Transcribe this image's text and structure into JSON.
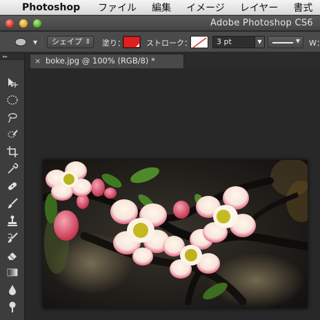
{
  "menubar": {
    "app_name": "Photoshop",
    "menus": [
      "ファイル",
      "編集",
      "イメージ",
      "レイヤー",
      "書式"
    ]
  },
  "window": {
    "title": "Adobe Photoshop CS6"
  },
  "options_bar": {
    "mode": "シェイプ",
    "fill_label": "塗り：",
    "fill_color": "#e02020",
    "stroke_label": "ストローク：",
    "stroke_width": "3 pt",
    "w_label": "W："
  },
  "document": {
    "tab_title": "boke.jpg @ 100% (RGB/8) *",
    "close_glyph": "×"
  },
  "tools": [
    {
      "name": "move-tool-icon"
    },
    {
      "name": "ellipse-marquee-icon"
    },
    {
      "name": "lasso-icon"
    },
    {
      "name": "quick-selection-icon"
    },
    {
      "name": "crop-icon"
    },
    {
      "name": "eyedropper-icon"
    },
    {
      "name": "spot-healing-icon"
    },
    {
      "name": "brush-icon"
    },
    {
      "name": "clone-stamp-icon"
    },
    {
      "name": "history-brush-icon"
    },
    {
      "name": "eraser-icon"
    },
    {
      "name": "gradient-icon"
    },
    {
      "name": "blur-icon"
    },
    {
      "name": "dodge-icon"
    }
  ]
}
